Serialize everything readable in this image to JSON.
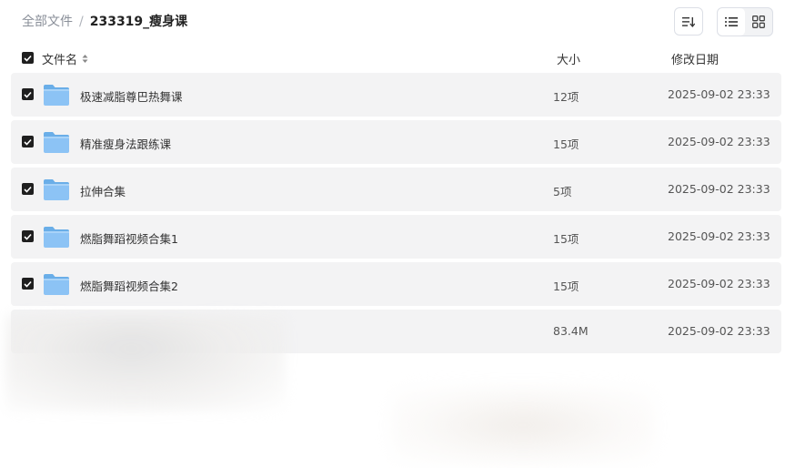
{
  "breadcrumb": {
    "root": "全部文件",
    "separator": "/",
    "current": "233319_瘦身课"
  },
  "toolbar": {
    "sort_icon": "sort-icon",
    "list_icon": "list-view-icon",
    "grid_icon": "grid-view-icon"
  },
  "header": {
    "name": "文件名",
    "size": "大小",
    "date": "修改日期"
  },
  "rows": [
    {
      "name": "极速减脂尊巴热舞课",
      "size": "12项",
      "date": "2025-09-02 23:33",
      "checked": true
    },
    {
      "name": "精准瘦身法跟练课",
      "size": "15项",
      "date": "2025-09-02 23:33",
      "checked": true
    },
    {
      "name": "拉伸合集",
      "size": "5项",
      "date": "2025-09-02 23:33",
      "checked": true
    },
    {
      "name": "燃脂舞蹈视频合集1",
      "size": "15项",
      "date": "2025-09-02 23:33",
      "checked": true
    },
    {
      "name": "燃脂舞蹈视频合集2",
      "size": "15项",
      "date": "2025-09-02 23:33",
      "checked": true
    },
    {
      "name": "",
      "size": "83.4M",
      "date": "2025-09-02 23:33",
      "checked": false
    }
  ],
  "colors": {
    "folder_body": "#8cc3f5",
    "folder_tab": "#6aaee8",
    "row_bg": "#f3f3f4",
    "checkbox": "#1f1f1f"
  }
}
